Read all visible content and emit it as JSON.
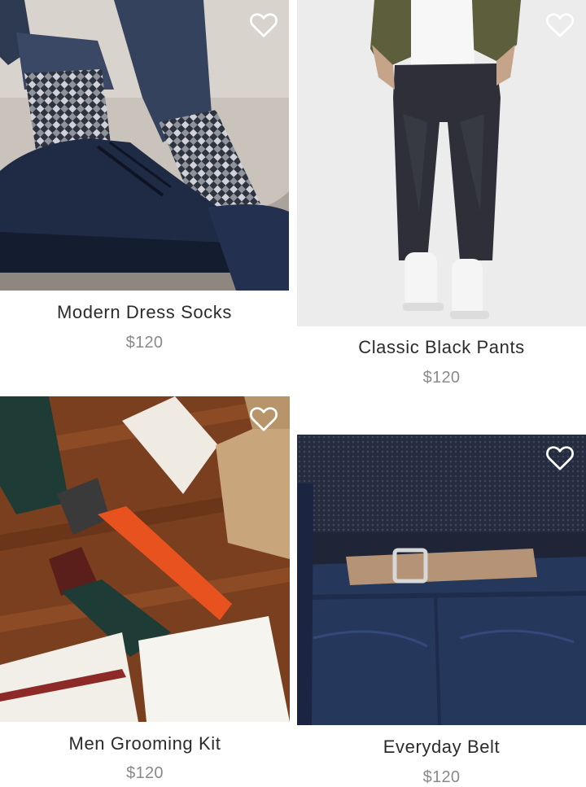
{
  "products": [
    {
      "name": "Modern Dress Socks",
      "price": "$120",
      "favorite_icon": "heart-outline-icon"
    },
    {
      "name": "Classic Black Pants",
      "price": "$120",
      "favorite_icon": "heart-outline-icon"
    },
    {
      "name": "Men Grooming Kit",
      "price": "$120",
      "favorite_icon": "heart-outline-icon"
    },
    {
      "name": "Everyday Belt",
      "price": "$120",
      "favorite_icon": "heart-outline-icon"
    }
  ],
  "colors": {
    "title": "#2b2b2b",
    "price": "#8a8a8a",
    "heart": "#ffffff"
  }
}
